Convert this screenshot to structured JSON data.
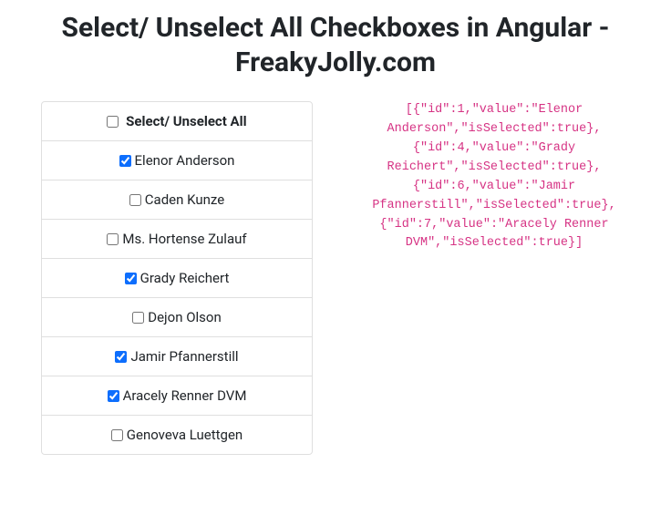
{
  "title": "Select/ Unselect All Checkboxes in Angular - FreakyJolly.com",
  "selectAll": {
    "label": "Select/ Unselect All",
    "checked": false
  },
  "items": [
    {
      "id": 1,
      "label": "Elenor Anderson",
      "checked": true
    },
    {
      "id": 2,
      "label": "Caden Kunze",
      "checked": false
    },
    {
      "id": 3,
      "label": "Ms. Hortense Zulauf",
      "checked": false
    },
    {
      "id": 4,
      "label": "Grady Reichert",
      "checked": true
    },
    {
      "id": 5,
      "label": "Dejon Olson",
      "checked": false
    },
    {
      "id": 6,
      "label": "Jamir Pfannerstill",
      "checked": true
    },
    {
      "id": 7,
      "label": "Aracely Renner DVM",
      "checked": true
    },
    {
      "id": 8,
      "label": "Genoveva Luettgen",
      "checked": false
    }
  ],
  "codeOutput": "[{\"id\":1,\"value\":\"Elenor Anderson\",\"isSelected\":true},{\"id\":4,\"value\":\"Grady Reichert\",\"isSelected\":true},{\"id\":6,\"value\":\"Jamir Pfannerstill\",\"isSelected\":true},{\"id\":7,\"value\":\"Aracely Renner DVM\",\"isSelected\":true}]"
}
